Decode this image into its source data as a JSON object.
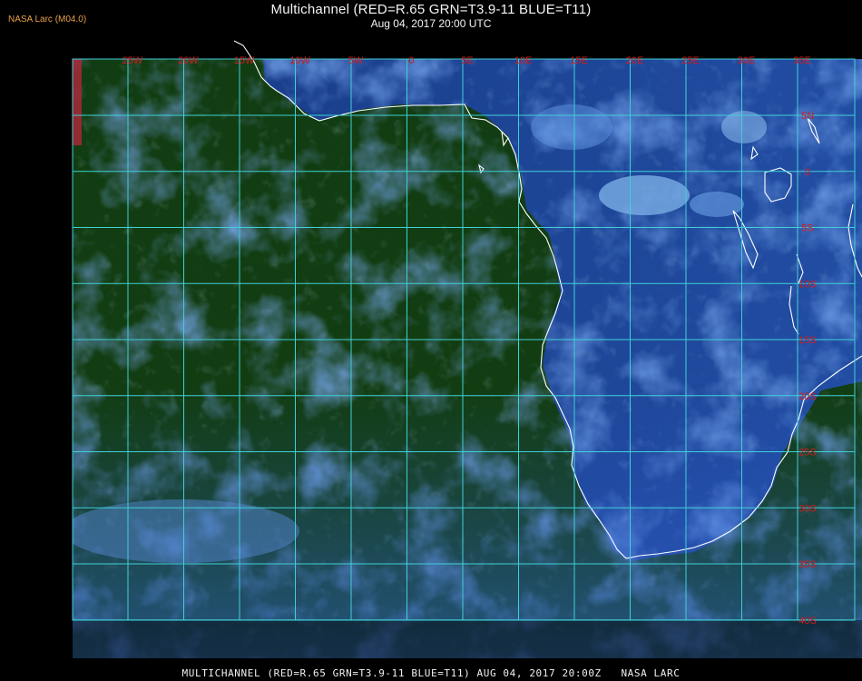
{
  "header": {
    "title": "Multichannel (RED=R.65 GRN=T3.9-11 BLUE=T11)",
    "datetime": "Aug 04, 2017 20:00 UTC",
    "credit": "NASA Larc (M04.0)"
  },
  "footer": {
    "caption": "MULTICHANNEL (RED=R.65 GRN=T3.9-11 BLUE=T11) AUG 04, 2017 20:00Z   NASA LARC"
  },
  "map": {
    "longitudes": [
      "25W",
      "20W",
      "15W",
      "10W",
      "5W",
      "0",
      "5E",
      "10E",
      "15E",
      "20E",
      "25E",
      "30E",
      "35E"
    ],
    "latitudes": [
      "5N",
      "0",
      "5S",
      "10S",
      "15S",
      "20S",
      "25S",
      "30S",
      "35S",
      "40S"
    ],
    "colors": {
      "grid": "#3fd0d8",
      "labels": "#d61a1a",
      "coastline": "#ffffff",
      "ocean_dark": "#123d12",
      "cloud_blue": "#2e5fd6",
      "cloud_light": "#7fb4ea"
    }
  }
}
